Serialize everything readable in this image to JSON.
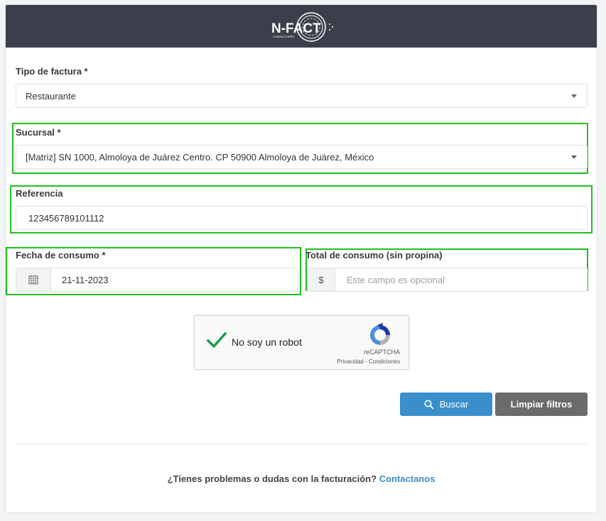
{
  "brand": {
    "logo_text": "N-FACT",
    "logo_subtext": "CONSULTORES"
  },
  "form": {
    "tipo_factura": {
      "label": "Tipo de factura *",
      "value": "Restaurante"
    },
    "sucursal": {
      "label": "Sucursal *",
      "value": "[Matriz] SN 1000, Almoloya de Juárez Centro. CP 50900 Almoloya de Juárez, México"
    },
    "referencia": {
      "label": "Referencia",
      "value": "123456789101112"
    },
    "fecha_consumo": {
      "label": "Fecha de consumo *",
      "value": "21-11-2023",
      "icon": "calendar-icon"
    },
    "total_consumo": {
      "label": "Total de consumo (sin propina)",
      "addon": "$",
      "placeholder": "Este campo es opcional"
    }
  },
  "recaptcha": {
    "label": "No soy un robot",
    "brand": "reCAPTCHA",
    "links": "Privacidad - Condiciones",
    "checked": true
  },
  "buttons": {
    "search": "Buscar",
    "clear": "Limpiar filtros"
  },
  "footer": {
    "text": "¿Tienes problemas o dudas con la facturación?",
    "link": "Contactanos"
  },
  "colors": {
    "header_bg": "#3c3f4b",
    "primary": "#3a8fcb",
    "highlight": "#1fc01f",
    "check": "#1a9e4a"
  }
}
